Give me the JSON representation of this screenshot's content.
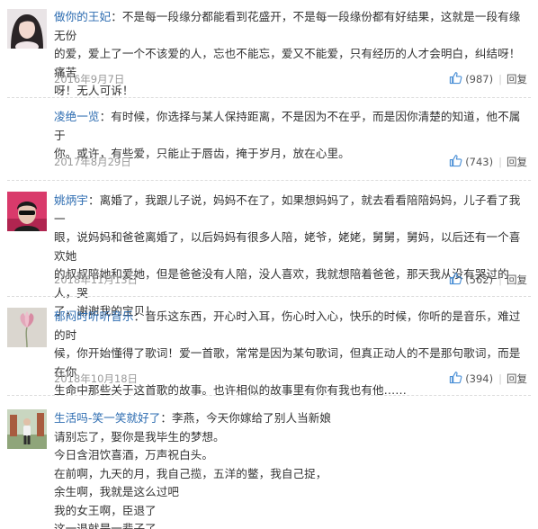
{
  "comments": [
    {
      "username": "做你的王妃",
      "lines": [
        "：不是每一段缘分都能看到花盛开，不是每一段缘份都有好结果，这就是一段有缘无份",
        "的爱，爱上了一个不该爱的人，忘也不能忘，爱又不能爱，只有经历的人才会明白，纠结呀！痛苦",
        "呀！无人可诉！"
      ],
      "date": "2016年9月7日",
      "likes": "(987)",
      "reply": "回复"
    },
    {
      "username": "凌绝一览",
      "lines": [
        "：有时候，你选择与某人保持距离，不是因为不在乎，而是因你清楚的知道，他不属于",
        "你。或许，有些爱，只能止于唇齿，掩于岁月，放在心里。"
      ],
      "date": "2017年8月29日",
      "likes": "(743)",
      "reply": "回复"
    },
    {
      "username": "姚炳宇",
      "lines": [
        "：离婚了，我跟儿子说，妈妈不在了，如果想妈妈了，就去看看陪陪妈妈，儿子看了我一",
        "眼，说妈妈和爸爸离婚了，以后妈妈有很多人陪，姥爷，姥姥，舅舅，舅妈，以后还有一个喜欢她",
        "的叔叔陪她和爱她，但是爸爸没有人陪，没人喜欢，我就想陪着爸爸，那天我从没有哭过的人，哭",
        "了，谢谢我的宝贝！"
      ],
      "date": "2018年11月13日",
      "likes": "(562)",
      "reply": "回复"
    },
    {
      "username": "郁闷时听听音乐",
      "lines": [
        "：音乐这东西，开心时入耳，伤心时入心，快乐的时候，你听的是音乐，难过的时",
        "候，你开始懂得了歌词！爱一首歌，常常是因为某句歌词，但真正动人的不是那句歌词，而是在你",
        "生命中那些关于这首歌的故事。也许相似的故事里有你有我也有他……"
      ],
      "date": "2018年10月18日",
      "likes": "(394)",
      "reply": "回复"
    },
    {
      "username": "生活吗-笑一笑就好了",
      "lines": [
        "：李燕，今天你嫁给了别人当新娘",
        "请别忘了，娶你是我毕生的梦想。",
        "今日含泪饮喜酒，万声祝白头。",
        "在前啊，九天的月，我自己揽，五洋的鳖，我自己捉，",
        "余生啊，我就是这么过吧",
        "我的女王啊，臣退了",
        "这一退就是一辈子了。"
      ]
    }
  ],
  "colors": {
    "username": "#2b6bb0",
    "text": "#333333",
    "meta": "#9a9a9a",
    "like_icon": "#4a8fd6"
  },
  "icons": {
    "like": "thumbs-up-icon"
  }
}
